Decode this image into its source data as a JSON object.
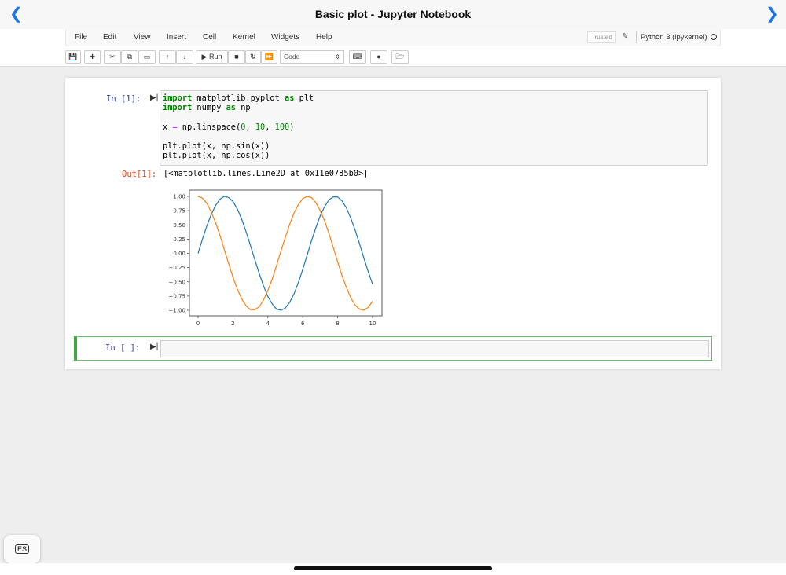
{
  "window": {
    "title": "Basic plot - Jupyter Notebook",
    "back_icon": "chevron-left",
    "forward_icon": "chevron-right"
  },
  "menu": [
    "File",
    "Edit",
    "View",
    "Insert",
    "Cell",
    "Kernel",
    "Widgets",
    "Help"
  ],
  "status": {
    "trusted": "Trusted",
    "kernel": "Python 3 (ipykernel)"
  },
  "toolbar": {
    "run_label": "Run",
    "cell_type": "Code"
  },
  "cells": [
    {
      "prompt": "In [1]:",
      "code": [
        "import matplotlib.pyplot as plt",
        "import numpy as np",
        "",
        "x = np.linspace(0, 10, 100)",
        "",
        "plt.plot(x, np.sin(x))",
        "plt.plot(x, np.cos(x))"
      ],
      "out_prompt": "Out[1]:",
      "output": "[<matplotlib.lines.Line2D at 0x11e0785b0>]"
    },
    {
      "prompt": "In [ ]:",
      "code": []
    }
  ],
  "keyboard_badge": "ES",
  "chart_data": {
    "type": "line",
    "title": "",
    "xlabel": "",
    "ylabel": "",
    "xlim": [
      -0.5,
      10.5
    ],
    "ylim": [
      -1.1,
      1.1
    ],
    "xticks": [
      "0",
      "2",
      "4",
      "6",
      "8",
      "10"
    ],
    "yticks": [
      "1.00",
      "0.75",
      "0.50",
      "0.25",
      "0.00",
      "−0.25",
      "−0.50",
      "−0.75",
      "−1.00"
    ],
    "grid": false,
    "x": [
      0,
      0.25,
      0.5,
      0.75,
      1,
      1.25,
      1.5,
      1.75,
      2,
      2.25,
      2.5,
      2.75,
      3,
      3.25,
      3.5,
      3.75,
      4,
      4.25,
      4.5,
      4.75,
      5,
      5.25,
      5.5,
      5.75,
      6,
      6.25,
      6.5,
      6.75,
      7,
      7.25,
      7.5,
      7.75,
      8,
      8.25,
      8.5,
      8.75,
      9,
      9.25,
      9.5,
      9.75,
      10
    ],
    "series": [
      {
        "name": "sin(x)",
        "color": "#1f77b4",
        "values": [
          0,
          0.25,
          0.48,
          0.68,
          0.84,
          0.95,
          1.0,
          0.98,
          0.91,
          0.78,
          0.6,
          0.38,
          0.14,
          -0.11,
          -0.35,
          -0.57,
          -0.76,
          -0.89,
          -0.98,
          -1.0,
          -0.96,
          -0.86,
          -0.71,
          -0.51,
          -0.28,
          -0.03,
          0.22,
          0.45,
          0.66,
          0.82,
          0.94,
          0.99,
          0.99,
          0.92,
          0.8,
          0.62,
          0.41,
          0.17,
          -0.08,
          -0.32,
          -0.54
        ]
      },
      {
        "name": "cos(x)",
        "color": "#ff7f0e",
        "values": [
          1,
          0.97,
          0.88,
          0.73,
          0.54,
          0.32,
          0.07,
          -0.18,
          -0.42,
          -0.63,
          -0.8,
          -0.92,
          -0.99,
          -0.99,
          -0.94,
          -0.82,
          -0.65,
          -0.45,
          -0.21,
          0.04,
          0.28,
          0.51,
          0.71,
          0.86,
          0.96,
          1.0,
          0.98,
          0.89,
          0.75,
          0.57,
          0.35,
          0.1,
          -0.15,
          -0.39,
          -0.6,
          -0.78,
          -0.91,
          -0.98,
          -1.0,
          -0.95,
          -0.84
        ]
      }
    ]
  }
}
